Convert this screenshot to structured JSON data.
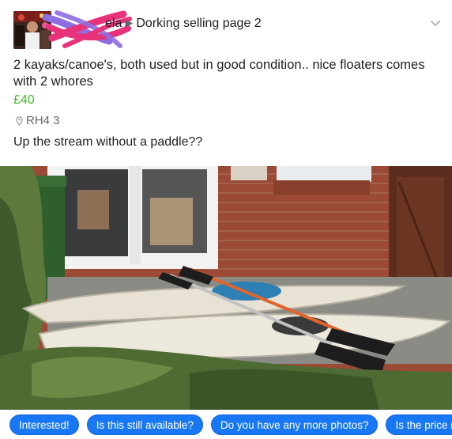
{
  "header": {
    "group_owner_visible": "ela",
    "group_name": "Dorking selling page 2"
  },
  "listing": {
    "title": "2 kayaks/canoe's, both used but in good condition.. nice floaters comes with 2 whores",
    "price": "£40",
    "location": "RH4 3",
    "description": "Up the stream without a paddle??"
  },
  "quick_replies": [
    "Interested!",
    "Is this still available?",
    "Do you have any more photos?",
    "Is the price n"
  ],
  "colors": {
    "price": "#42b72a",
    "chip": "#1877f2",
    "scribble_pink": "#e8327a",
    "scribble_purple": "#8e6ee0"
  },
  "icons": [
    "location-pin-icon",
    "chevron-down-icon",
    "breadcrumb-arrow-icon"
  ]
}
